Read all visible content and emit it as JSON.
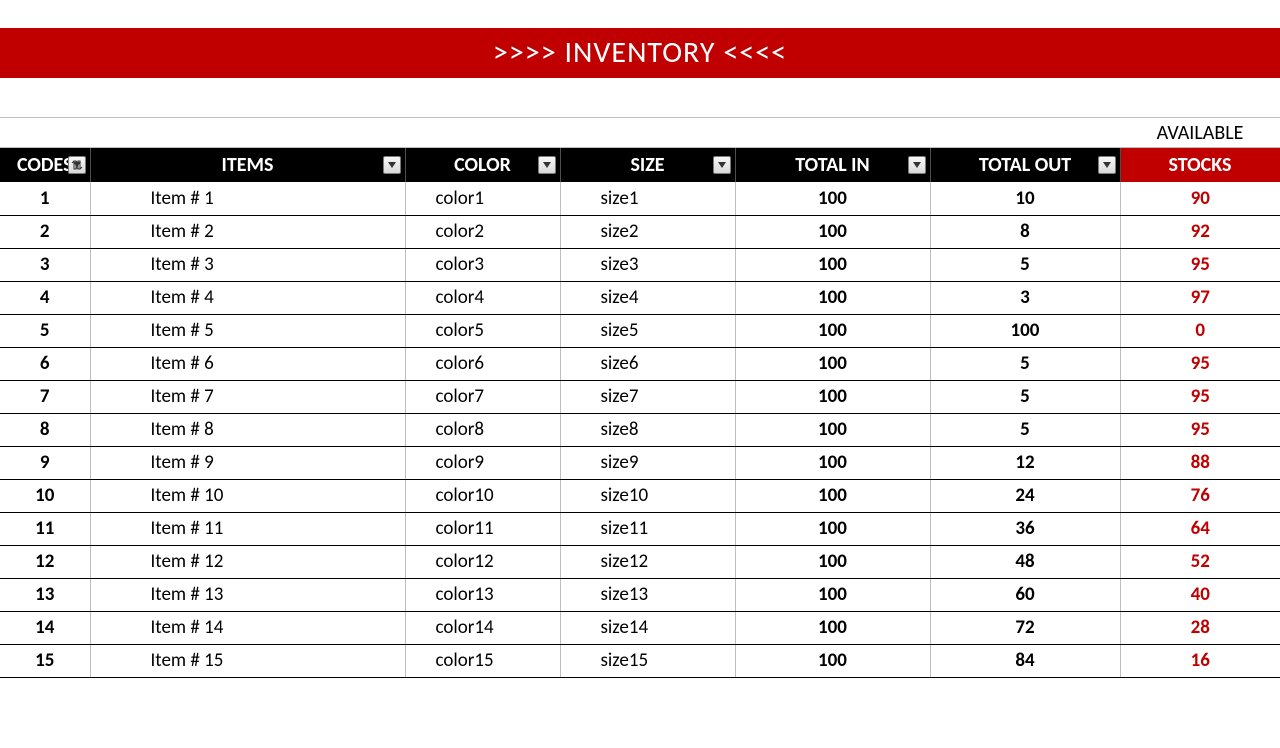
{
  "banner": ">>>> INVENTORY <<<<",
  "available_label": "AVAILABLE",
  "headers": {
    "codes": "CODES",
    "items": "ITEMS",
    "color": "COLOR",
    "size": "SIZE",
    "total_in": "TOTAL IN",
    "total_out": "TOTAL OUT",
    "stocks": "STOCKS"
  },
  "rows": [
    {
      "code": "1",
      "item": "Item # 1",
      "color": "color1",
      "size": "size1",
      "tin": "100",
      "tout": "10",
      "stock": "90"
    },
    {
      "code": "2",
      "item": "Item # 2",
      "color": "color2",
      "size": "size2",
      "tin": "100",
      "tout": "8",
      "stock": "92"
    },
    {
      "code": "3",
      "item": "Item # 3",
      "color": "color3",
      "size": "size3",
      "tin": "100",
      "tout": "5",
      "stock": "95"
    },
    {
      "code": "4",
      "item": "Item # 4",
      "color": "color4",
      "size": "size4",
      "tin": "100",
      "tout": "3",
      "stock": "97"
    },
    {
      "code": "5",
      "item": "Item # 5",
      "color": "color5",
      "size": "size5",
      "tin": "100",
      "tout": "100",
      "stock": "0"
    },
    {
      "code": "6",
      "item": "Item # 6",
      "color": "color6",
      "size": "size6",
      "tin": "100",
      "tout": "5",
      "stock": "95"
    },
    {
      "code": "7",
      "item": "Item # 7",
      "color": "color7",
      "size": "size7",
      "tin": "100",
      "tout": "5",
      "stock": "95"
    },
    {
      "code": "8",
      "item": "Item # 8",
      "color": "color8",
      "size": "size8",
      "tin": "100",
      "tout": "5",
      "stock": "95"
    },
    {
      "code": "9",
      "item": "Item # 9",
      "color": "color9",
      "size": "size9",
      "tin": "100",
      "tout": "12",
      "stock": "88"
    },
    {
      "code": "10",
      "item": "Item # 10",
      "color": "color10",
      "size": "size10",
      "tin": "100",
      "tout": "24",
      "stock": "76"
    },
    {
      "code": "11",
      "item": "Item # 11",
      "color": "color11",
      "size": "size11",
      "tin": "100",
      "tout": "36",
      "stock": "64"
    },
    {
      "code": "12",
      "item": "Item # 12",
      "color": "color12",
      "size": "size12",
      "tin": "100",
      "tout": "48",
      "stock": "52"
    },
    {
      "code": "13",
      "item": "Item # 13",
      "color": "color13",
      "size": "size13",
      "tin": "100",
      "tout": "60",
      "stock": "40"
    },
    {
      "code": "14",
      "item": "Item # 14",
      "color": "color14",
      "size": "size14",
      "tin": "100",
      "tout": "72",
      "stock": "28"
    },
    {
      "code": "15",
      "item": "Item # 15",
      "color": "color15",
      "size": "size15",
      "tin": "100",
      "tout": "84",
      "stock": "16"
    }
  ],
  "chart_data": {
    "type": "table",
    "title": "INVENTORY",
    "columns": [
      "CODES",
      "ITEMS",
      "COLOR",
      "SIZE",
      "TOTAL IN",
      "TOTAL OUT",
      "STOCKS"
    ],
    "data": [
      [
        1,
        "Item # 1",
        "color1",
        "size1",
        100,
        10,
        90
      ],
      [
        2,
        "Item # 2",
        "color2",
        "size2",
        100,
        8,
        92
      ],
      [
        3,
        "Item # 3",
        "color3",
        "size3",
        100,
        5,
        95
      ],
      [
        4,
        "Item # 4",
        "color4",
        "size4",
        100,
        3,
        97
      ],
      [
        5,
        "Item # 5",
        "color5",
        "size5",
        100,
        100,
        0
      ],
      [
        6,
        "Item # 6",
        "color6",
        "size6",
        100,
        5,
        95
      ],
      [
        7,
        "Item # 7",
        "color7",
        "size7",
        100,
        5,
        95
      ],
      [
        8,
        "Item # 8",
        "color8",
        "size8",
        100,
        5,
        95
      ],
      [
        9,
        "Item # 9",
        "color9",
        "size9",
        100,
        12,
        88
      ],
      [
        10,
        "Item # 10",
        "color10",
        "size10",
        100,
        24,
        76
      ],
      [
        11,
        "Item # 11",
        "color11",
        "size11",
        100,
        36,
        64
      ],
      [
        12,
        "Item # 12",
        "color12",
        "size12",
        100,
        48,
        52
      ],
      [
        13,
        "Item # 13",
        "color13",
        "size13",
        100,
        60,
        40
      ],
      [
        14,
        "Item # 14",
        "color14",
        "size14",
        100,
        72,
        28
      ],
      [
        15,
        "Item # 15",
        "color15",
        "size15",
        100,
        84,
        16
      ]
    ]
  }
}
